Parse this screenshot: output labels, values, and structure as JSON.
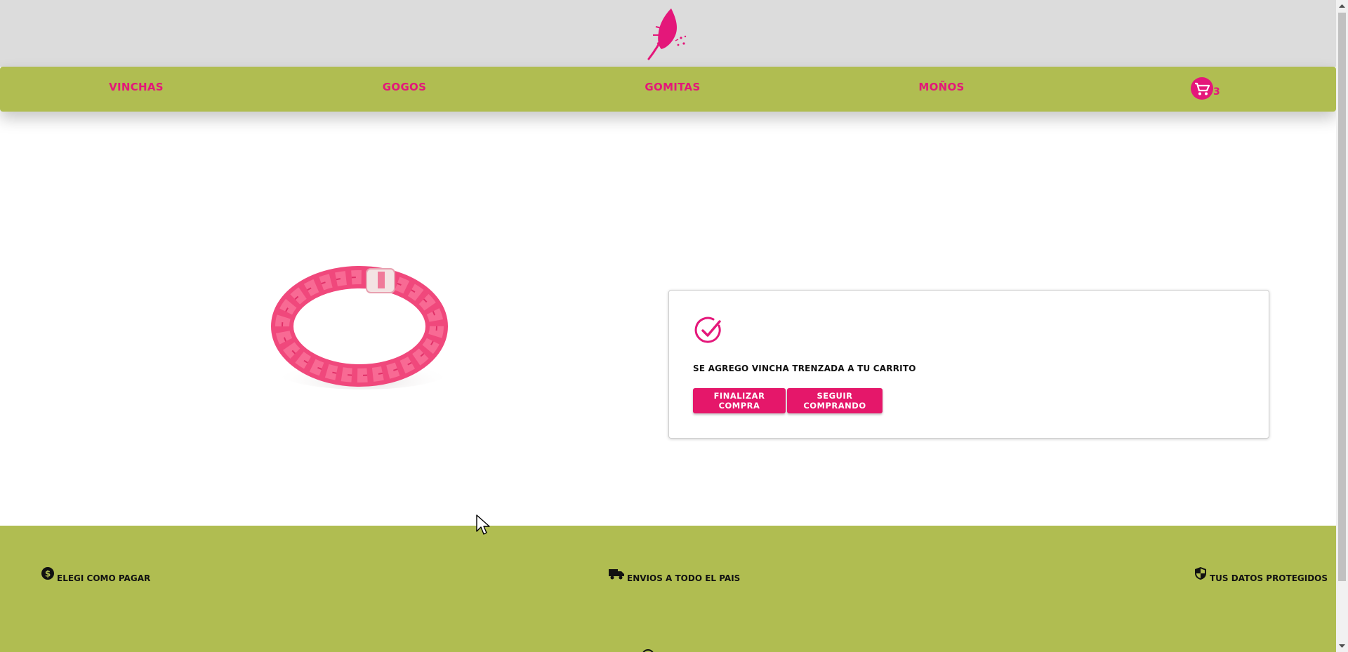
{
  "header": {
    "logo_icon": "feather-logo-icon",
    "nav": {
      "vinchas": "VINCHAS",
      "gogos": "GOGOS",
      "gomitas": "GOMITAS",
      "monos": "MOÑOS"
    },
    "cart": {
      "icon": "shopping-cart-icon",
      "count": "3"
    }
  },
  "product": {
    "image_icon": "braided-headband-image"
  },
  "confirmation": {
    "icon": "check-circle-icon",
    "message": "SE AGREGO VINCHA TRENZADA A TU CARRITO",
    "finalize_button": "FINALIZAR COMPRA",
    "continue_button": "SEGUIR COMPRANDO"
  },
  "footer": {
    "pay": {
      "icon": "dollar-icon",
      "label": "ELEGI COMO PAGAR"
    },
    "ship": {
      "icon": "truck-icon",
      "label": "ENVIOS A TODO EL PAIS"
    },
    "safe": {
      "icon": "shield-icon",
      "label": "TUS DATOS PROTEGIDOS"
    }
  },
  "colors": {
    "accent_pink": "#e4177a",
    "nav_green": "#b0bd51",
    "header_gray": "#dcdcdc",
    "button_pink": "#e5176a"
  }
}
